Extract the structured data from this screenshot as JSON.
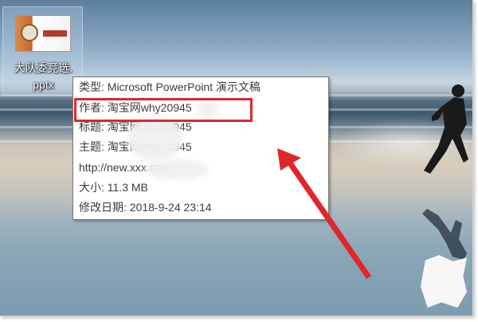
{
  "desktop": {
    "icon_label": "大队委竞选.pptx",
    "icon_label_line1": "大队委竞选.",
    "icon_label_line2": "pptx"
  },
  "tooltip": {
    "type": "类型: Microsoft PowerPoint 演示文稿",
    "author": "作者: 淘宝网why20945",
    "title": "标题: 淘宝网why20945",
    "subject": "主题: 淘宝网why20945",
    "url": "http://new.xxx.com",
    "size": "大小: 11.3 MB",
    "modified": "修改日期: 2018-9-24 23:14"
  },
  "colors": {
    "highlight": "#e0272b",
    "arrow": "#e0272b"
  }
}
